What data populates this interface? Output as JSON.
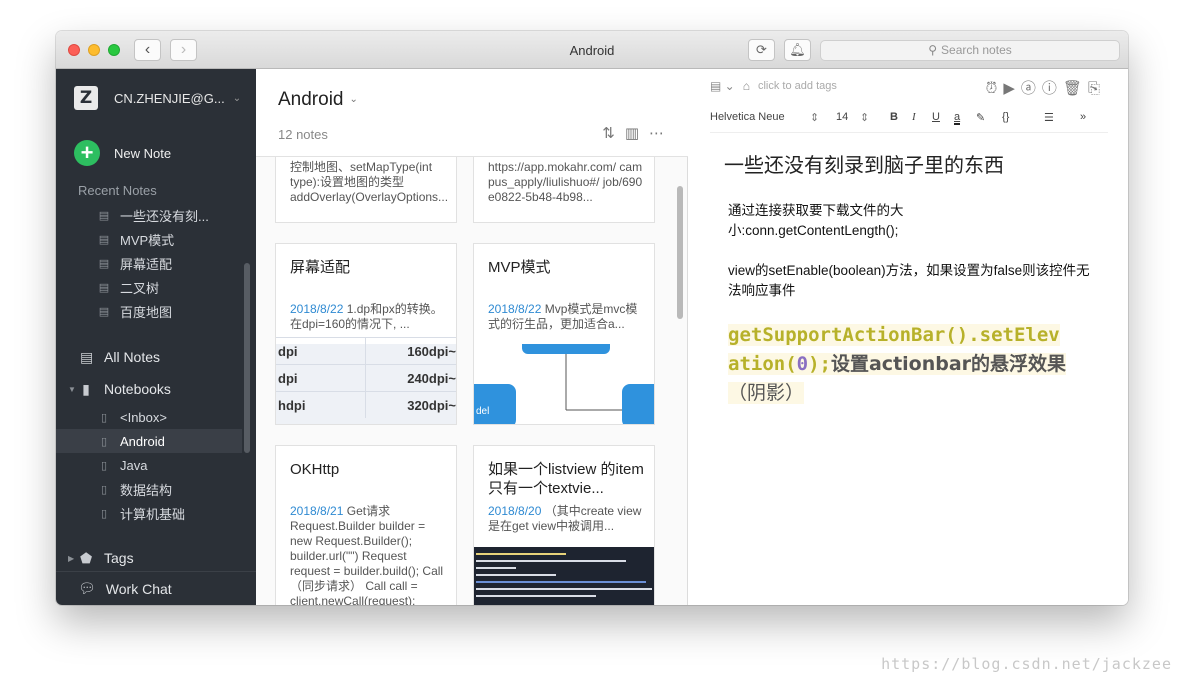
{
  "window": {
    "title": "Android"
  },
  "search": {
    "placeholder": "Search notes"
  },
  "sidebar": {
    "account": "CN.ZHENJIE@G...",
    "new_note": "New Note",
    "recent_label": "Recent Notes",
    "recent": [
      "一些还没有刻...",
      "MVP模式",
      "屏幕适配",
      "二叉树",
      "百度地图"
    ],
    "all_notes": "All Notes",
    "notebooks_label": "Notebooks",
    "notebooks": [
      "<Inbox>",
      "Android",
      "Java",
      "数据结构",
      "计算机基础"
    ],
    "active_notebook": "Android",
    "tags": "Tags",
    "work_chat": "Work Chat"
  },
  "notelist": {
    "title": "Android",
    "count": "12 notes",
    "cards": [
      {
        "title": "",
        "date": "",
        "text": "控制地图、setMapType(int type):设置地图的类型 addOverlay(OverlayOptions..."
      },
      {
        "title": "",
        "date": "",
        "text": "https://app.mokahr.com/ campus_apply/liulishuo#/ job/690e0822-5b48-4b98..."
      },
      {
        "title": "屏幕适配",
        "date": "2018/8/22",
        "text": "1.dp和px的转换。在dpi=160的情况下, ..."
      },
      {
        "title": "MVP模式",
        "date": "2018/8/22",
        "text": "Mvp模式是mvc模式的衍生品，更加适合a..."
      },
      {
        "title": "OKHttp",
        "date": "2018/8/21",
        "text": "Get请求 Request.Builder builder = new Request.Builder(); builder.url(\"\") Request request = builder.build(); Call（同步请求） Call call = client.newCall(request); Res..."
      },
      {
        "title": "如果一个listview 的item只有一个textvie...",
        "date": "2018/8/20",
        "text": "（其中create view是在get view中被调用..."
      }
    ],
    "thumb_table": [
      [
        "dpi",
        "160dpi~"
      ],
      [
        "dpi",
        "240dpi~"
      ],
      [
        "hdpi",
        "320dpi~"
      ]
    ],
    "thumb_diagram_label": "del"
  },
  "editor": {
    "tags_placeholder": "click to add tags",
    "font": "Helvetica Neue",
    "font_size": "14",
    "title": "一些还没有刻录到脑子里的东西",
    "paragraphs": [
      "通过连接获取要下载文件的大小:conn.getContentLength();",
      "view的setEnable(boolean)方法，如果设置为false则该控件无法响应事件"
    ],
    "code": {
      "line1": "getSupportActionBar().setElev",
      "line2_a": "ation(",
      "line2_num": "0",
      "line2_b": ");",
      "line2_cn": "设置actionbar的悬浮效果",
      "line3_cn": "（阴影）"
    }
  },
  "watermark": "https://blog.csdn.net/jackzee"
}
